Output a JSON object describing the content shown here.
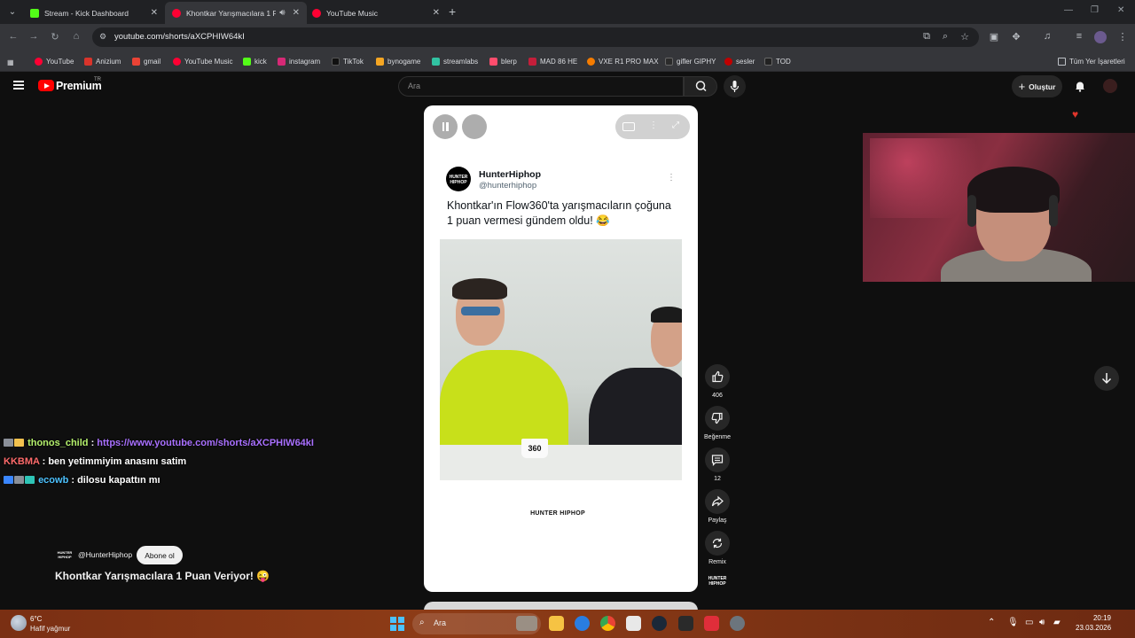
{
  "browser": {
    "tabs": [
      {
        "title": "Stream - Kick Dashboard",
        "favicon_color": "#53fc18",
        "active": false
      },
      {
        "title": "Khontkar Yarışmacılara 1 Pu",
        "favicon_color": "#ff0033",
        "active": true
      },
      {
        "title": "YouTube Music",
        "favicon_color": "#ff0033",
        "active": false
      }
    ],
    "url": "youtube.com/shorts/aXCPHIW64kI",
    "bookmarks": [
      {
        "label": "YouTube",
        "color": "#ff0033"
      },
      {
        "label": "Anizium",
        "color": "#d9342b"
      },
      {
        "label": "gmail",
        "color": "#ea4335"
      },
      {
        "label": "YouTube Music",
        "color": "#ff0033"
      },
      {
        "label": "kick",
        "color": "#53fc18"
      },
      {
        "label": "instagram",
        "color": "#d62976"
      },
      {
        "label": "TikTok",
        "color": "#111111"
      },
      {
        "label": "bynogame",
        "color": "#f5a623"
      },
      {
        "label": "streamlabs",
        "color": "#31c3a2"
      },
      {
        "label": "blerp",
        "color": "#ff4d6d"
      },
      {
        "label": "MAD 86 HE",
        "color": "#c41e3a"
      },
      {
        "label": "VXE R1 PRO MAX",
        "color": "#f57c00"
      },
      {
        "label": "gifler GIPHY",
        "color": "#2b2b2b"
      },
      {
        "label": "sesler",
        "color": "#c00000"
      },
      {
        "label": "TOD",
        "color": "#222222"
      }
    ],
    "all_bookmarks": "Tüm Yer İşaretleri"
  },
  "youtube": {
    "brand": "Premium",
    "country": "TR",
    "search_placeholder": "Ara",
    "create_label": "Oluştur"
  },
  "short": {
    "account_name": "HunterHiphop",
    "account_handle": "@hunterhiphop",
    "post_text": "Khontkar'ın Flow360'ta yarışmacıların çoğuna 1 puan vermesi gündem oldu! 😂",
    "mug_text": "360",
    "watermark": "HUNTER HIPHOP",
    "actions": {
      "likes": "406",
      "dislike_label": "Beğenme",
      "comments": "12",
      "share_label": "Paylaş",
      "remix_label": "Remix"
    },
    "channel_handle": "@HunterHiphop",
    "subscribe_label": "Abone ol",
    "title": "Khontkar Yarışmacılara 1 Puan Veriyor! 😜"
  },
  "chat": [
    {
      "user": "thonos_child",
      "user_color": "#b4f06c",
      "separator": " : ",
      "message": "https://www.youtube.com/shorts/aXCPHIW64kI",
      "message_color": "#a970ff"
    },
    {
      "user": "KKBMA",
      "user_color": "#ff6b6b",
      "separator": " : ",
      "message": "ben yetimmiyim anasını satim",
      "message_color": "#ffffff"
    },
    {
      "user": "ecowb",
      "user_color": "#4cc2ff",
      "separator": " : ",
      "message": "dilosu kapattın mı",
      "message_color": "#ffffff"
    }
  ],
  "taskbar": {
    "temperature": "6°C",
    "weather": "Hafif yağmur",
    "search_placeholder": "Ara",
    "time": "20:19",
    "date": "23.03.2026"
  }
}
